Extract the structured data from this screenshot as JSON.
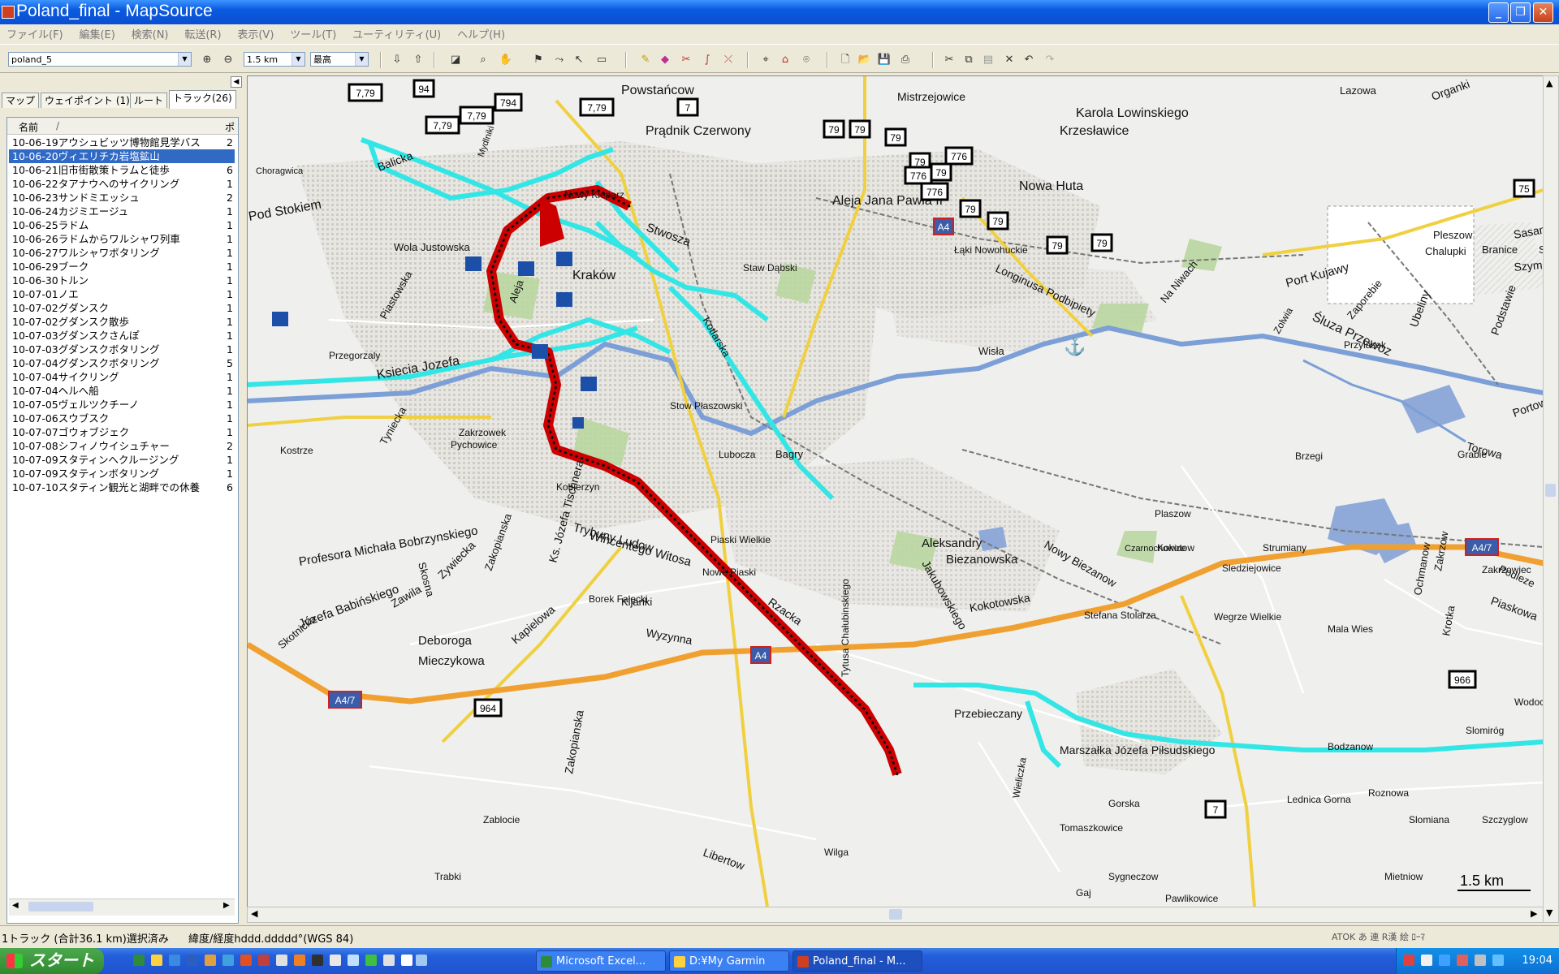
{
  "window": {
    "title": "Poland_final - MapSource",
    "min": "_",
    "max": "❐",
    "close": "✕"
  },
  "menu": [
    "ファイル(F)",
    "編集(E)",
    "検索(N)",
    "転送(R)",
    "表示(V)",
    "ツール(T)",
    "ユーティリティ(U)",
    "ヘルプ(H)"
  ],
  "toolbar": {
    "map_product": "poland_5",
    "zoom_level": "1.5 km",
    "detail": "最高"
  },
  "tabs": [
    {
      "label": "マップ"
    },
    {
      "label": "ウェイポイント (1)"
    },
    {
      "label": "ルート"
    },
    {
      "label": "トラック(26)"
    }
  ],
  "list": {
    "col_name": "名前",
    "col_sort": "/",
    "col2": "ポ",
    "rows": [
      {
        "name": "10-06-19アウシュビッツ博物館見学バス",
        "val": "2"
      },
      {
        "name": "10-06-20ヴィエリチカ岩塩鉱山",
        "val": "",
        "selected": true
      },
      {
        "name": "10-06-21旧市街散策トラムと徒歩",
        "val": "6"
      },
      {
        "name": "10-06-22タアナウへのサイクリング",
        "val": "1"
      },
      {
        "name": "10-06-23サンドミエッシュ",
        "val": "2"
      },
      {
        "name": "10-06-24カジミエージュ",
        "val": "1"
      },
      {
        "name": "10-06-25ラドム",
        "val": "1"
      },
      {
        "name": "10-06-26ラドムからワルシャワ列車",
        "val": "1"
      },
      {
        "name": "10-06-27ワルシャワボタリング",
        "val": "1"
      },
      {
        "name": "10-06-29ブーク",
        "val": "1"
      },
      {
        "name": "10-06-30トルン",
        "val": "1"
      },
      {
        "name": "10-07-01ノエ",
        "val": "1"
      },
      {
        "name": "10-07-02グダンスク",
        "val": "1"
      },
      {
        "name": "10-07-02グダンスク散歩",
        "val": "1"
      },
      {
        "name": "10-07-03グダンスクさんぽ",
        "val": "1"
      },
      {
        "name": "10-07-03グダンスクボタリング",
        "val": "1"
      },
      {
        "name": "10-07-04グダンスクボタリング",
        "val": "5"
      },
      {
        "name": "10-07-04サイクリング",
        "val": "1"
      },
      {
        "name": "10-07-04ヘルへ船",
        "val": "1"
      },
      {
        "name": "10-07-05ヴェルツクチーノ",
        "val": "1"
      },
      {
        "name": "10-07-06スウブスク",
        "val": "1"
      },
      {
        "name": "10-07-07ゴウォブジェク",
        "val": "1"
      },
      {
        "name": "10-07-08シフィノウイシュチャー",
        "val": "2"
      },
      {
        "name": "10-07-09スタティンへクルージング",
        "val": "1"
      },
      {
        "name": "10-07-09スタティンボタリング",
        "val": "1"
      },
      {
        "name": "10-07-10スタティン観光と湖畔での休養",
        "val": "6"
      }
    ]
  },
  "map": {
    "scale_label": "1.5 km",
    "labels": [
      "Powstańcow",
      "Prądnik Czerwony",
      "Mistrzejowice",
      "Karola Lowinskiego",
      "Krzesławice",
      "Lazowa",
      "Organki",
      "Nowa Huta",
      "Aleja Jana Pawła II",
      "Pleszow",
      "Chalupki",
      "Branice",
      "Stryjow",
      "Sasanek",
      "Szymanskiego",
      "Port Kujawy",
      "Łąki Nowohuckie",
      "Staw Dąbski",
      "Longinusa Podbipiety",
      "Na Niwach",
      "Wisła",
      "Śluza Przewoz",
      "Przylasek",
      "Zaporebie",
      "Ubeliny",
      "Zolwia",
      "Podstawie",
      "Portowa",
      "Torowa",
      "Grabie",
      "Brzegi",
      "Bagry",
      "Stow Płaszowski",
      "Kraków",
      "Nowy Kleparz",
      "Stwosza",
      "Kotlarska",
      "Balicka",
      "Pod Stokiem",
      "Wola Justowska",
      "Piastowska",
      "Aleja",
      "Ksiecia Jozefa",
      "Przegorzaly",
      "Tyniecka",
      "Zakrzowek",
      "Pychowice",
      "Kostrze",
      "Kobierzyn",
      "Profesora Michała Bobrzynskiego",
      "Skosna",
      "Zywiecka",
      "Zakopianska",
      "Ks. Józefa Tischnera",
      "Trybuny Ludow",
      "Wincentego Witosa",
      "Piaski Wielkie",
      "Nowe Piaski",
      "Borek Fałęcki",
      "Kijanki",
      "Rzacka",
      "Wyzynna",
      "Józefa Babińskiego",
      "Zawila",
      "Deboroga",
      "Mieczykowa",
      "Kapielowa",
      "Skotnicka",
      "Zakopianska",
      "Tytusa Chałubinskiego",
      "Jakubowskiego",
      "Aleksandry",
      "Biezanowska",
      "Nowy Biezanow",
      "Kokotowska",
      "Stefana Stolarza",
      "Czarnochowice",
      "Kokotow",
      "Sledziejowice",
      "Strumiany",
      "Wegrze Wielkie",
      "Mala Wies",
      "Ochmanow",
      "Zakrzow",
      "Krotka",
      "Zakrzowiec",
      "Podleze",
      "Piaskowa",
      "Wodocia",
      "Slomiróg",
      "Bodzanow",
      "Przebieczany",
      "Marszałka Józefa Piłsudskiego",
      "Wieliczka",
      "Gorska",
      "Lednica Gorna",
      "Tomaszkowice",
      "Roznowa",
      "Slomiana",
      "Szczyglow",
      "Zablocie",
      "Libertow",
      "Wilga",
      "Sygneczow",
      "Mietniow",
      "Trabki",
      "Gaj",
      "Pawlikowice",
      "Choragwica",
      "Mydlniki",
      "Lubocza",
      "Plaszow"
    ],
    "road_shields": [
      "7,79",
      "94",
      "7,79",
      "7,79",
      "794",
      "7,79",
      "7",
      "79",
      "79",
      "79",
      "79",
      "776",
      "776",
      "79",
      "776",
      "79",
      "79",
      "79",
      "79",
      "75",
      "776",
      "A4",
      "A4",
      "A4/7",
      "A4/7",
      "964",
      "966",
      "7"
    ]
  },
  "status": {
    "selection": "1トラック (合計36.1 km)選択済み",
    "coords": "緯度/経度hddd.ddddd°(WGS 84)",
    "ime": "ATOK あ 連 R漢 絵 ﾛｰﾏ"
  },
  "taskbar": {
    "start": "スタート",
    "tasks": [
      {
        "label": "Microsoft Excel..."
      },
      {
        "label": "D:¥My Garmin"
      },
      {
        "label": "Poland_final - M..."
      }
    ],
    "clock": "19:04"
  },
  "colors": {
    "track_selected": "#cc0000",
    "track_other": "#33e6e6",
    "highway": "#f0a030",
    "river": "#7b9fd6"
  }
}
